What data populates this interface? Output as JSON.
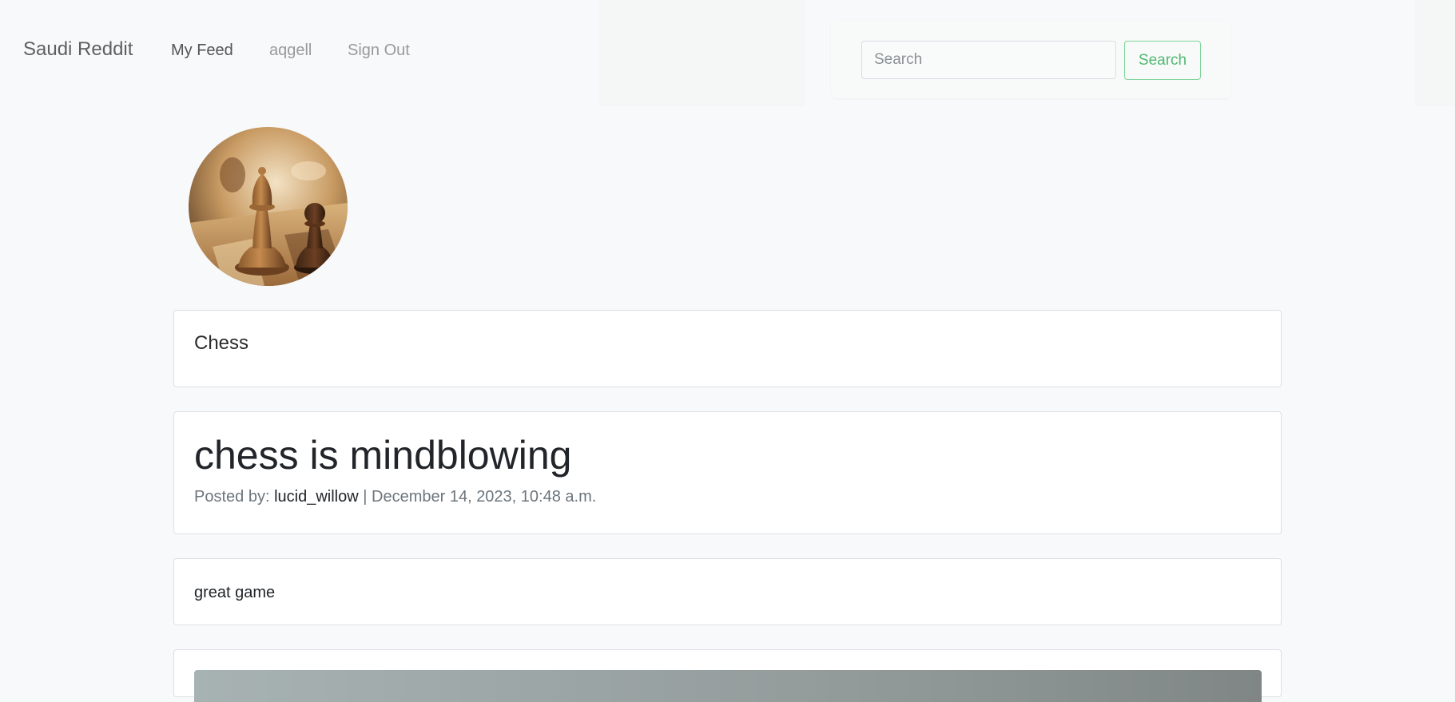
{
  "navbar": {
    "brand": "Saudi Reddit",
    "links": {
      "feed": "My Feed",
      "user": "aqgell",
      "signout": "Sign Out"
    },
    "search": {
      "placeholder": "Search",
      "button_label": "Search"
    }
  },
  "community": {
    "avatar_icon": "chess-pieces-image",
    "name": "Chess"
  },
  "post": {
    "title": "chess is mindblowing",
    "posted_by_label": "Posted by:",
    "author": "lucid_willow",
    "separator": "|",
    "timestamp": "December 14, 2023, 10:48 a.m.",
    "body": "great game"
  },
  "colors": {
    "background": "#f8f9fa",
    "card_border": "#dcdfe3",
    "search_accent": "#52b874"
  }
}
